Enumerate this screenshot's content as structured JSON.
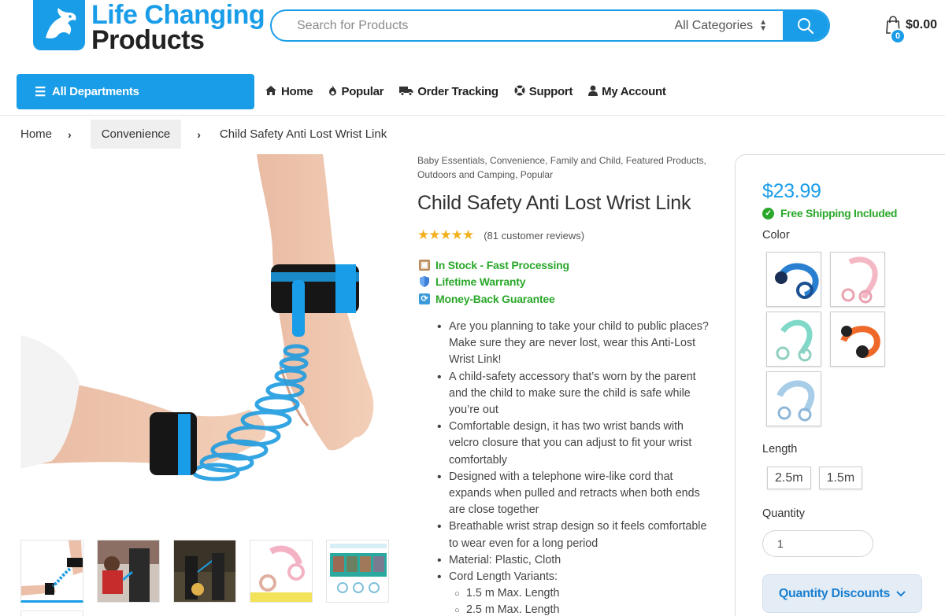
{
  "logo": {
    "line1": "Life Changing",
    "line2": "Products"
  },
  "search": {
    "placeholder": "Search for Products",
    "category": "All Categories"
  },
  "cart": {
    "count": "0",
    "total": "$0.00"
  },
  "nav": {
    "departments": "All Departments",
    "items": [
      {
        "label": "Home",
        "icon": "home-icon"
      },
      {
        "label": "Popular",
        "icon": "flame-icon"
      },
      {
        "label": "Order Tracking",
        "icon": "truck-icon"
      },
      {
        "label": "Support",
        "icon": "lifebuoy-icon"
      },
      {
        "label": "My Account",
        "icon": "user-icon"
      }
    ]
  },
  "breadcrumb": [
    "Home",
    "Convenience",
    "Child Safety Anti Lost Wrist Link"
  ],
  "product": {
    "categories": "Baby Essentials, Convenience, Family and Child, Featured Products, Outdoors and Camping, Popular",
    "title": "Child Safety Anti Lost Wrist Link",
    "stars": "★★★★★",
    "rating": 5,
    "reviews": "(81 customer reviews)",
    "perks": [
      "In Stock - Fast Processing",
      "Lifetime Warranty",
      "Money-Back Guarantee"
    ],
    "bullets": [
      "Are you planning to take your child to public places? Make sure they are never lost, wear this Anti-Lost Wrist Link!",
      "A child-safety accessory that’s worn by the parent and the child to make sure the child is safe while you’re out",
      "Comfortable design, it has two wrist bands with velcro closure that you can adjust to fit your wrist comfortably",
      "Designed with a telephone wire-like cord that expands when pulled and retracts when both ends are close together",
      "Breathable wrist strap design so it feels comfortable to wear even for a long period",
      "Material: Plastic, Cloth",
      "Cord Length Variants:"
    ],
    "variants": [
      "1.5 m Max. Length",
      "2.5 m Max. Length"
    ]
  },
  "buybox": {
    "price": "$23.99",
    "shipping": "Free Shipping Included",
    "color_label": "Color",
    "colors": [
      "blue",
      "pink",
      "teal",
      "orange",
      "light-blue"
    ],
    "length_label": "Length",
    "lengths": [
      "2.5m",
      "1.5m"
    ],
    "quantity_label": "Quantity",
    "quantity": "1",
    "discounts": "Quantity Discounts"
  },
  "colors": {
    "accent": "#1a9de8",
    "success": "#2aa82a",
    "star": "#f2b01e"
  }
}
